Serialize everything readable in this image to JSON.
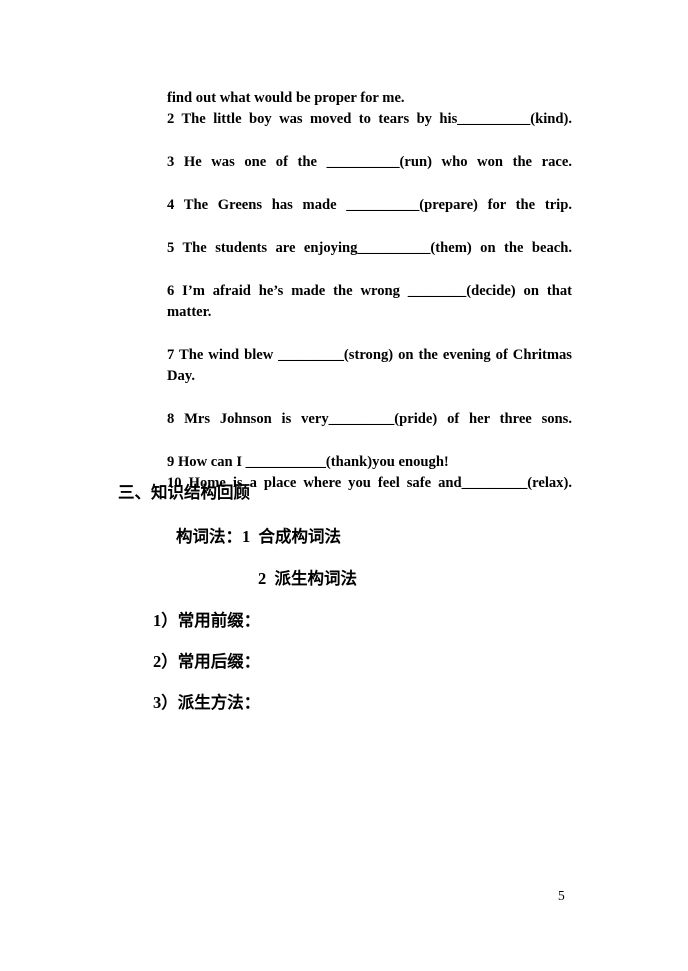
{
  "document": {
    "page_number": "5",
    "background_color": "#ffffff",
    "text_color": "#000000"
  },
  "exercise": {
    "continuation_line": "find out what would be proper for me.",
    "items": [
      {
        "number": "2",
        "text_before": "2  The  little  boy  was  moved  to  tears  by  his",
        "blank": "__________",
        "cue": "(kind).",
        "text_after": "",
        "full_text": "2  The  little  boy  was  moved  to  tears  by  his __________(kind)."
      },
      {
        "number": "3",
        "text_before": "3 He was one of the ",
        "blank": "__________",
        "cue": "(run)",
        "text_after": " who won the race.",
        "full_text": "3 He was one of the __________(run) who won the race."
      },
      {
        "number": "4",
        "text_before": "4  The  Greens  has  made  ",
        "blank": "__________",
        "cue": "(prepare)",
        "text_after": " for the trip.",
        "full_text": "4  The  Greens  has  made  __________(prepare) for the trip."
      },
      {
        "number": "5",
        "text_before": "5  The  students  are  enjoying",
        "blank": "__________",
        "cue": "(them)",
        "text_after": " on the beach.",
        "full_text": "5  The  students  are  enjoying__________(them) on the beach."
      },
      {
        "number": "6",
        "text_before": "6 I’m afraid he’s made the wrong ",
        "blank": "________",
        "cue": "(decide)",
        "text_after": " on that matter.",
        "full_text": "6 I’m afraid he’s made the wrong ________(decide) on that matter."
      },
      {
        "number": "7",
        "text_before": "7 The wind blew ",
        "blank": "_________",
        "cue": "(strong)",
        "text_after": " on the evening of Chritmas Day.",
        "full_text": "7 The wind blew _________(strong) on the evening of Chritmas Day."
      },
      {
        "number": "8",
        "text_before": "8  Mrs  Johnson  is  very",
        "blank": "_________",
        "cue": "(pride)",
        "text_after": " of her three sons.",
        "full_text": "8  Mrs  Johnson  is  very_________(pride) of her three sons."
      },
      {
        "number": "9",
        "text_before": "9 How can I ",
        "blank": "___________",
        "cue": "(thank)",
        "text_after": "you enough!",
        "full_text": "9 How can I ___________(thank)you enough!"
      },
      {
        "number": "10",
        "text_before": "10  Home  is  a  place  where  you  feel  safe  and",
        "blank": "_________",
        "cue": "(relax).",
        "text_after": "",
        "full_text": "10  Home  is  a  place  where  you  feel  safe  and _________(relax)."
      }
    ]
  },
  "outline": {
    "section_heading": "三、知识结构回顾",
    "word_formation_label": "构词法：1  合成构词法",
    "derivation_label": "2  派生构词法",
    "sub_items": [
      "1）常用前缀：",
      "2）常用后缀：",
      "3）派生方法："
    ]
  }
}
